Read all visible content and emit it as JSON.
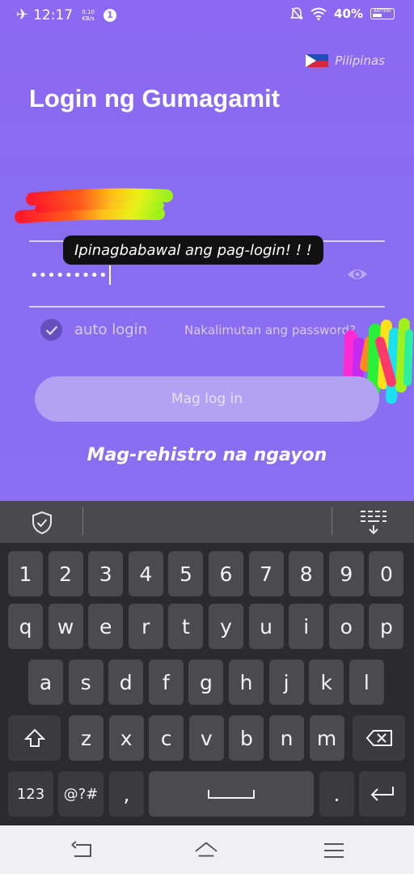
{
  "status_bar": {
    "time": "12:17",
    "speed_value": "0.10",
    "speed_unit": "KB/s",
    "notification_count": "1",
    "battery_percent": "40%",
    "battery_label": "BATTERY"
  },
  "language": {
    "label": "Pilipinas",
    "flag_icon": "philippines-flag-icon"
  },
  "page_title": "Login ng Gumagamit",
  "toast_message": "Ipinagbabawal ang pag-login! ! !",
  "password_field": {
    "masked_value": "•••••••••",
    "visibility_icon": "eye-icon"
  },
  "auto_login": {
    "label": "auto login",
    "checked": true
  },
  "forgot_password": "Nakalimutan ang password?",
  "login_button": "Mag log in",
  "register_link": "Mag-rehistro na ngayon",
  "keyboard": {
    "toolbar_icons": [
      "shield-check-icon",
      "keyboard-collapse-icon"
    ],
    "row_numbers": [
      "1",
      "2",
      "3",
      "4",
      "5",
      "6",
      "7",
      "8",
      "9",
      "0"
    ],
    "row_top": [
      "q",
      "w",
      "e",
      "r",
      "t",
      "y",
      "u",
      "i",
      "o",
      "p"
    ],
    "row_middle": [
      "a",
      "s",
      "d",
      "f",
      "g",
      "h",
      "j",
      "k",
      "l"
    ],
    "row_bottom": [
      "z",
      "x",
      "c",
      "v",
      "b",
      "n",
      "m"
    ],
    "key_123": "123",
    "key_symbols": "@?#",
    "key_comma": ",",
    "key_period": "."
  },
  "colors": {
    "background": "#8b69f2",
    "button": "#b2a2f3",
    "keyboard": "#2b2b2d"
  }
}
